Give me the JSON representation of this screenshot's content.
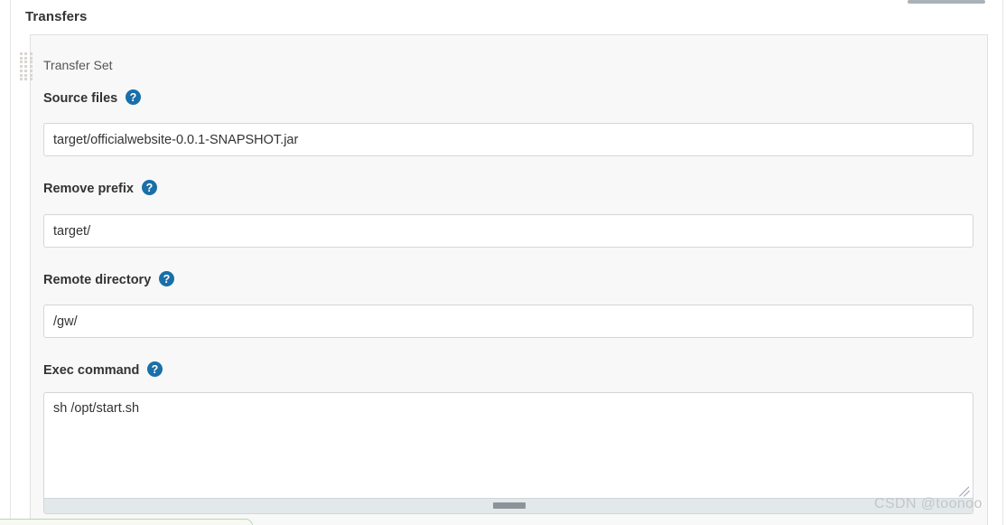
{
  "section": {
    "heading": "Transfers"
  },
  "transfer_set": {
    "block_title": "Transfer Set",
    "drag_handle_name": "drag-handle-icon",
    "fields": [
      {
        "id": "source-files",
        "label": "Source files",
        "help_icon": "help-icon",
        "value": "target/officialwebsite-0.0.1-SNAPSHOT.jar",
        "placeholder": "",
        "type": "text"
      },
      {
        "id": "remove-prefix",
        "label": "Remove prefix",
        "help_icon": "help-icon",
        "value": "target/",
        "placeholder": "",
        "type": "text"
      },
      {
        "id": "remote-directory",
        "label": "Remote directory",
        "help_icon": "help-icon",
        "value": "/gw/",
        "placeholder": "",
        "type": "text"
      },
      {
        "id": "exec-command",
        "label": "Exec command",
        "help_icon": "help-icon",
        "value": "sh /opt/start.sh",
        "placeholder": "",
        "type": "textarea"
      }
    ]
  },
  "watermark": {
    "text": "CSDN @toonoo"
  },
  "colors": {
    "help_icon_blue": "#1a6fa8",
    "panel_background": "#f8f8f8",
    "input_border": "#d6d6d6",
    "heading_text": "#333333",
    "block_title_text": "#555555",
    "watermark_text": "#c2c7cc",
    "scrollbar_thumb": "#8d9499",
    "scrollbar_track": "#e3e8ea"
  }
}
